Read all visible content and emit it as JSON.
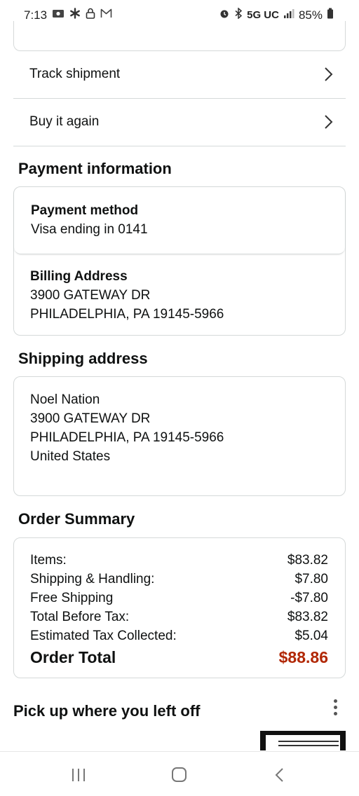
{
  "status_bar": {
    "time": "7:13",
    "network": "5G UC",
    "battery": "85%"
  },
  "order_actions": [
    {
      "label": "Track shipment"
    },
    {
      "label": "Buy it again"
    }
  ],
  "payment": {
    "title": "Payment information",
    "method_heading": "Payment method",
    "method_value": "Visa ending in 0141",
    "billing_heading": "Billing Address",
    "billing_line1": "3900 GATEWAY DR",
    "billing_line2": "PHILADELPHIA, PA 19145-5966"
  },
  "shipping": {
    "title": "Shipping address",
    "name": "Noel Nation",
    "line1": "3900 GATEWAY DR",
    "line2": "PHILADELPHIA, PA 19145-5966",
    "country": "United States"
  },
  "summary": {
    "title": "Order Summary",
    "rows": [
      {
        "label": "Items:",
        "value": "$83.82"
      },
      {
        "label": "Shipping & Handling:",
        "value": "$7.80"
      },
      {
        "label": "Free Shipping",
        "value": "-$7.80"
      },
      {
        "label": "Total Before Tax:",
        "value": "$83.82"
      },
      {
        "label": "Estimated Tax Collected:",
        "value": "$5.04"
      }
    ],
    "total_label": "Order Total",
    "total_value": "$88.86",
    "total_color": "#b12704"
  },
  "pickup": {
    "title": "Pick up where you left off"
  },
  "icons": {
    "chevron": "chevron-right-icon",
    "more": "kebab-menu-icon",
    "nav_recent": "recent-apps-icon",
    "nav_home": "home-icon",
    "nav_back": "back-icon"
  }
}
